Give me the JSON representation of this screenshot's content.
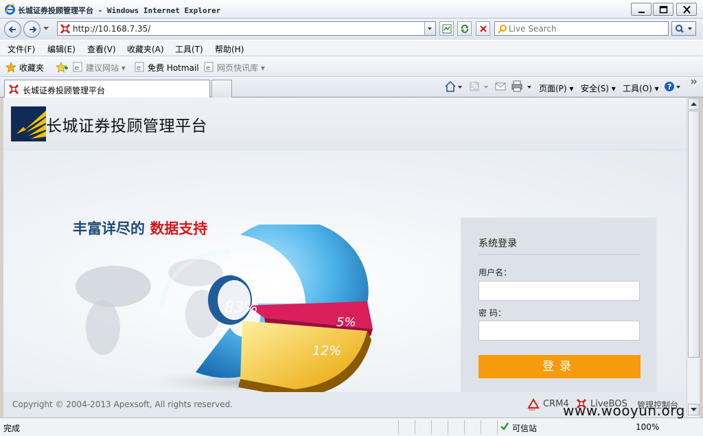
{
  "window": {
    "title": "长城证券投顾管理平台 - Windows Internet Explorer"
  },
  "address": {
    "url": "http://10.168.7.35/",
    "search_placeholder": "Live Search"
  },
  "menu": [
    "文件(F)",
    "编辑(E)",
    "查看(V)",
    "收藏夹(A)",
    "工具(T)",
    "帮助(H)"
  ],
  "favorites": {
    "label": "收藏夹",
    "items": [
      "建议网站 ▾",
      "免费 Hotmail",
      "网页快讯库 ▾"
    ]
  },
  "tab": {
    "label": "长城证券投顾管理平台"
  },
  "commands": [
    "页面(P) ▾",
    "安全(S) ▾",
    "工具(O) ▾"
  ],
  "page": {
    "title": "长城证券投顾管理平台",
    "slogan_a": "丰富详尽的 ",
    "slogan_b": "数据支持",
    "chart_labels": [
      "83%",
      "5%",
      "12%"
    ],
    "login": {
      "title": "系统登录",
      "username_label": "用户名：",
      "password_label": "密 码：",
      "submit": "登录"
    },
    "footer": {
      "copyright": "Copyright © 2004-2013 Apexsoft, All rights reserved.",
      "links": [
        "CRM4",
        "LiveBOS",
        "管理控制台"
      ]
    }
  },
  "status": {
    "text": "完成",
    "zone": "可信站",
    "zoom": "100%"
  },
  "watermark": "www.wooyun.org",
  "colors": {
    "login_button": "#f59b0c",
    "slogan_highlight": "#d8161b",
    "slogan_main": "#1d4a7a"
  }
}
